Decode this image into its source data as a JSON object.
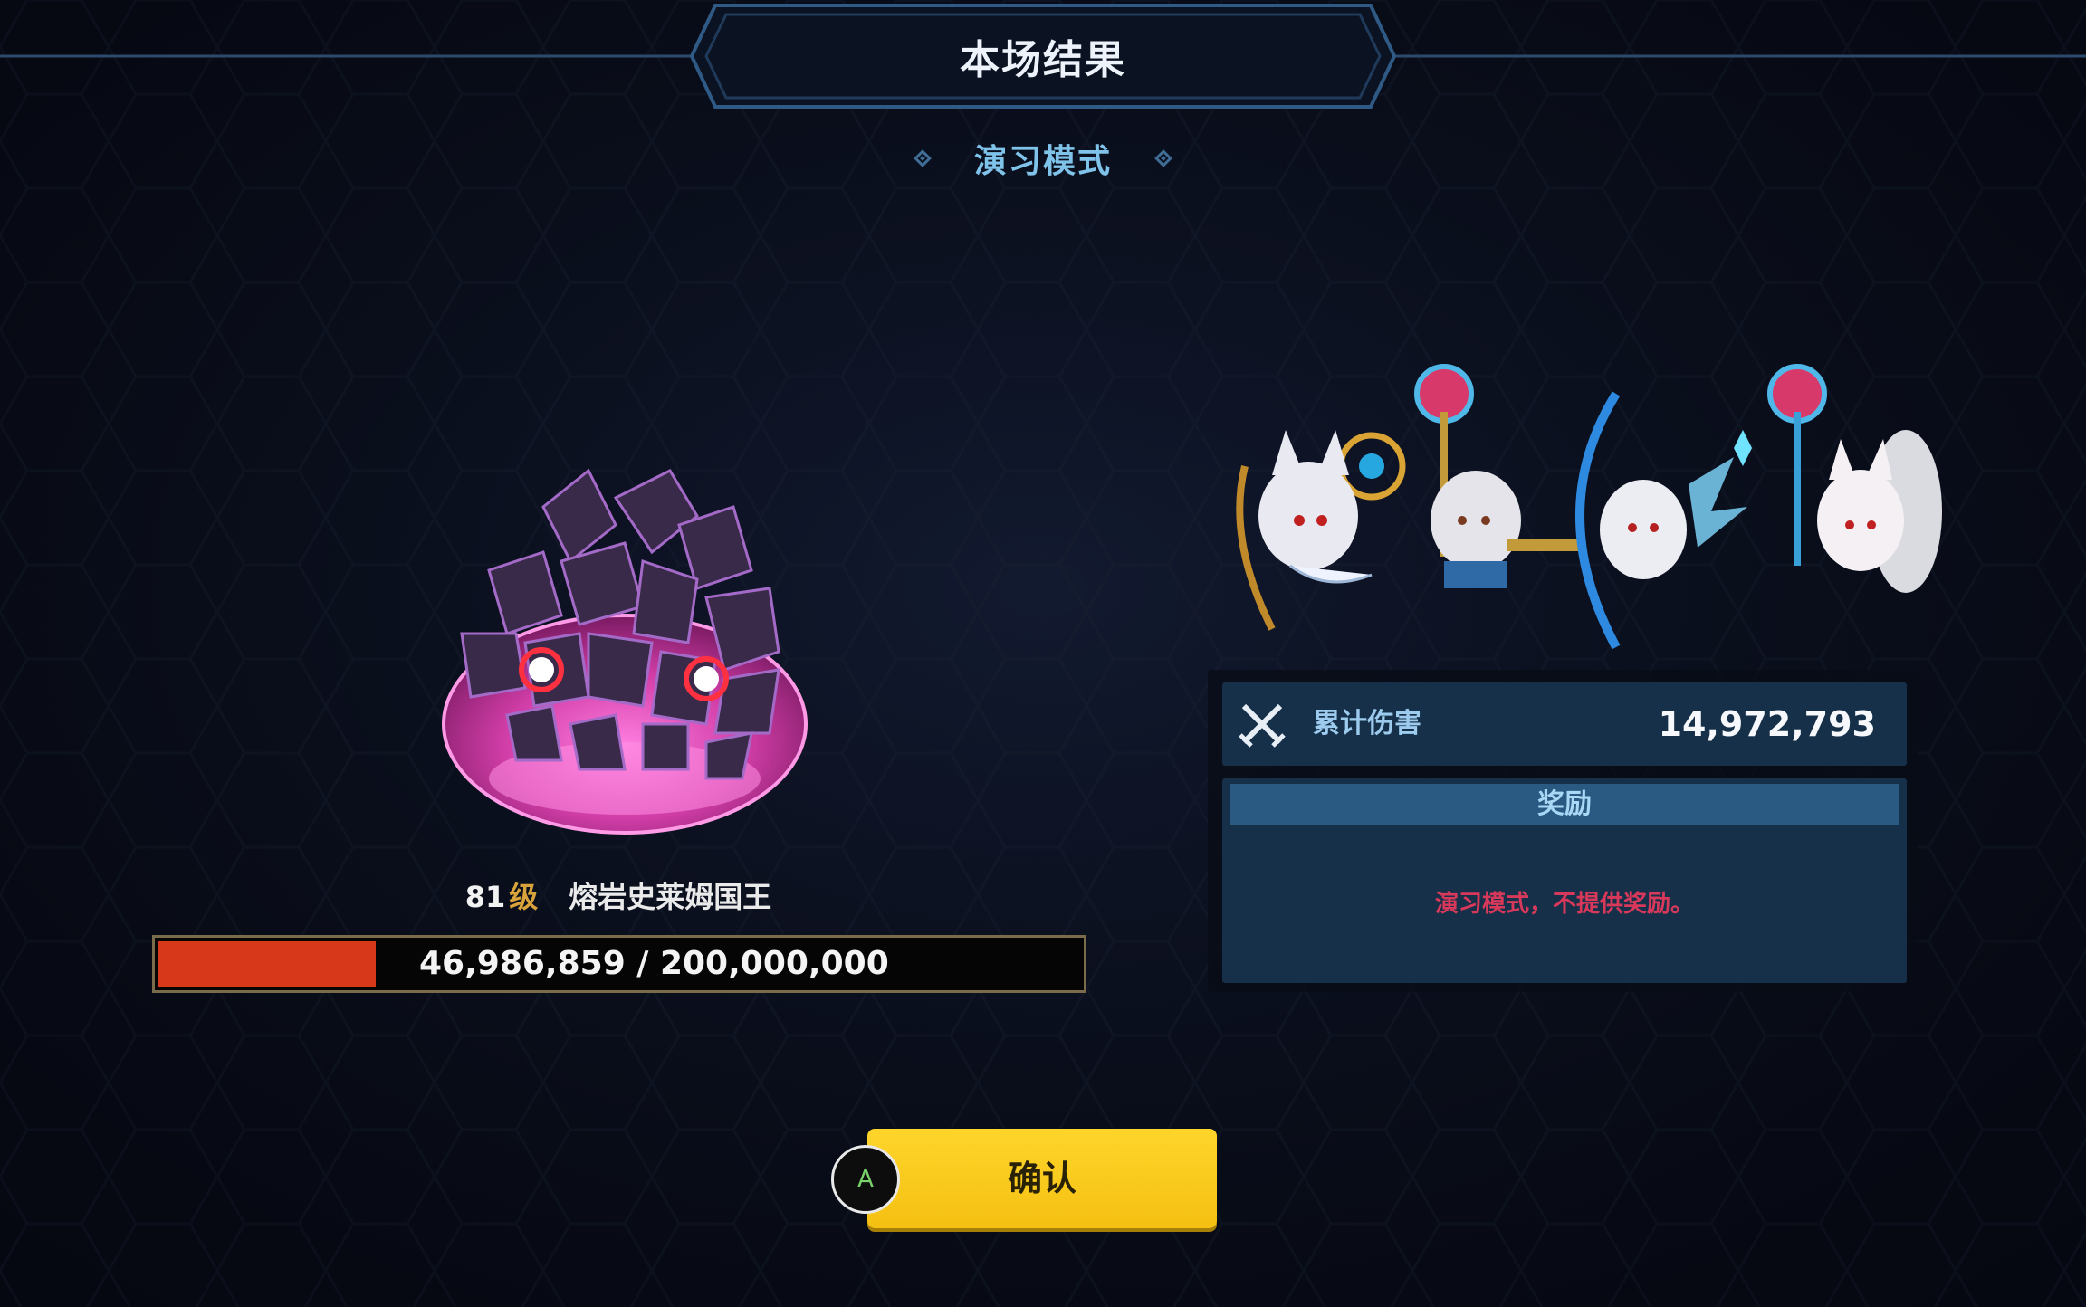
{
  "header": {
    "title": "本场结果",
    "mode": "演习模式"
  },
  "boss": {
    "level_number": "81",
    "level_unit": "级",
    "name": "熔岩史莱姆国王",
    "hp_text": "46,986,859 / 200,000,000",
    "hp_current": 46986859,
    "hp_max": 200000000
  },
  "result": {
    "damage_label": "累计伤害",
    "damage_value": "14,972,793",
    "reward_title": "奖励",
    "reward_note": "演习模式，不提供奖励。"
  },
  "party": {
    "members": [
      {
        "icon": "fox-eared-archer-heroine"
      },
      {
        "icon": "white-haired-staff-mage"
      },
      {
        "icon": "winged-bow-knight"
      },
      {
        "icon": "nine-tailed-fox-mage"
      }
    ]
  },
  "footer": {
    "confirm_label": "确认",
    "gamepad_key": "A"
  },
  "colors": {
    "hp_fill": "#d7381a",
    "confirm_bg": "#ffd52b",
    "panel_bg": "#16304a",
    "reward_header": "#2a5a82",
    "warning_text": "#d8395a",
    "accent_blue": "#7fc3ea"
  }
}
